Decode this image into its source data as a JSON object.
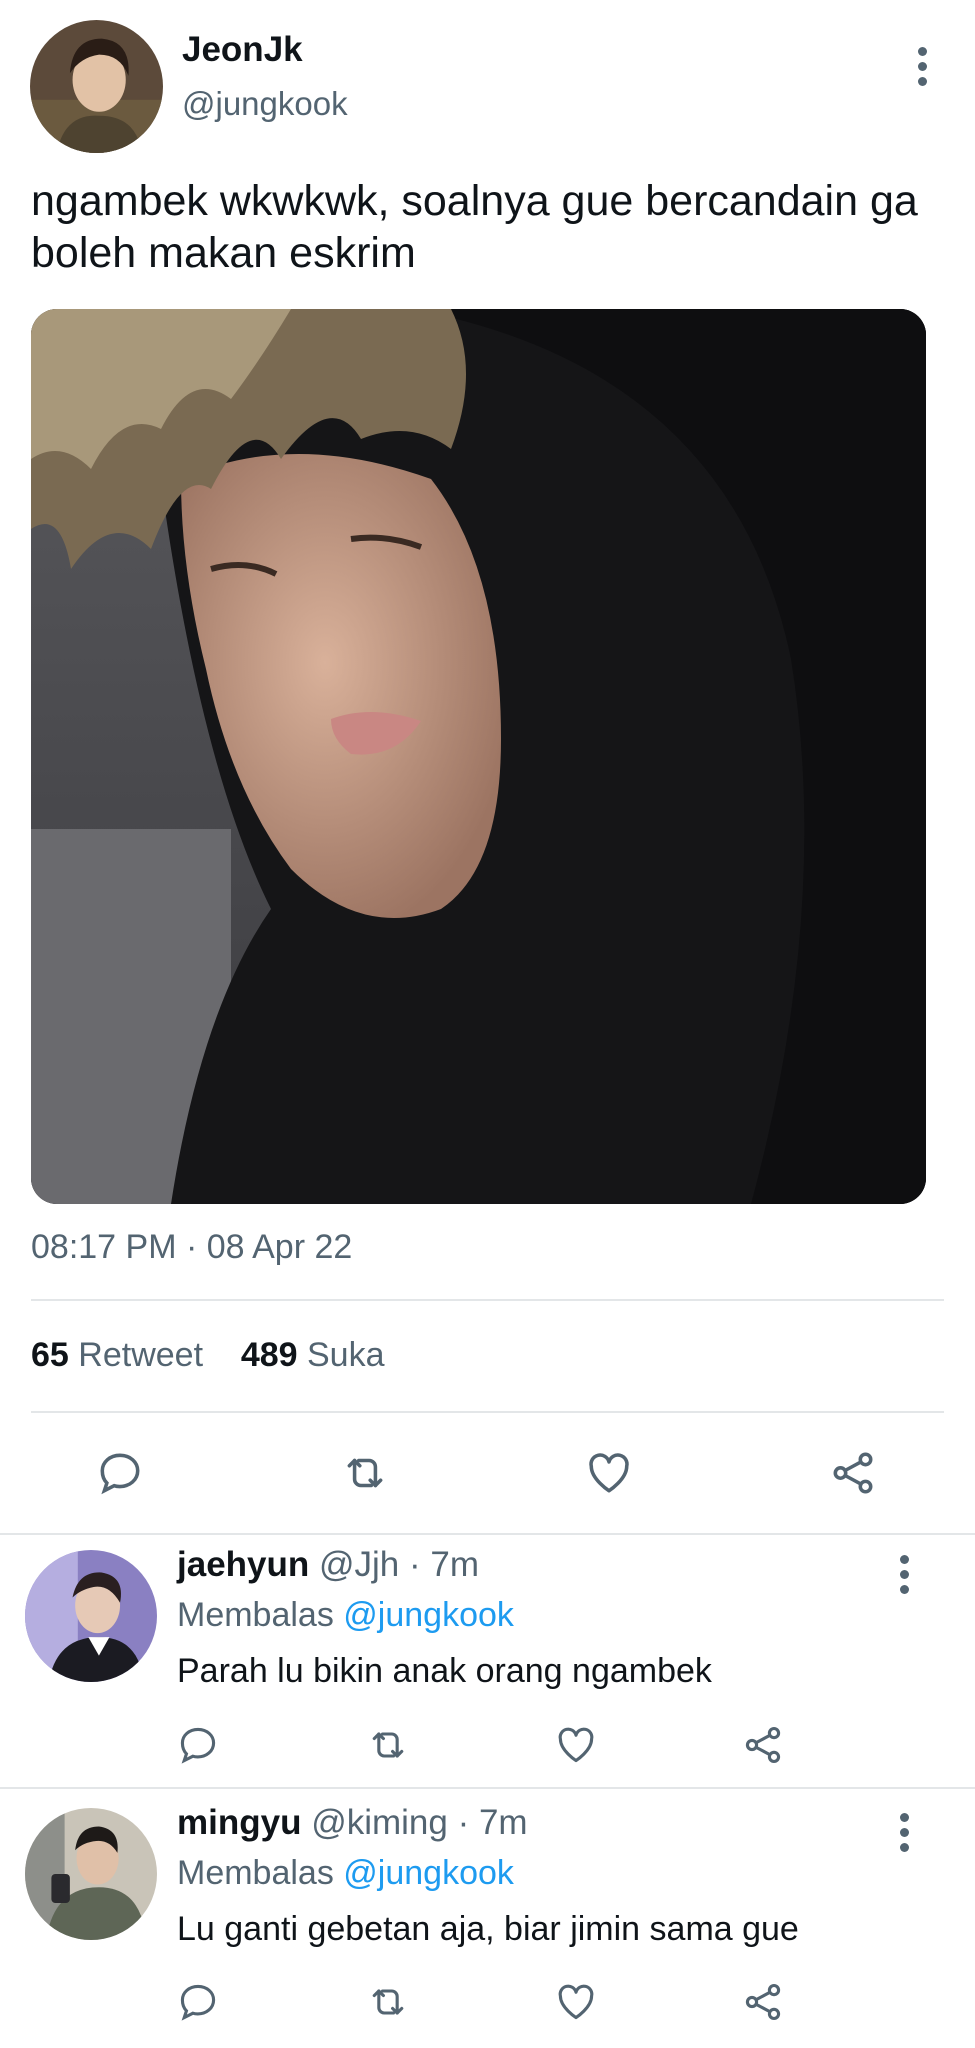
{
  "tweet": {
    "display_name": "JeonJk",
    "handle": "@jungkook",
    "text": "ngambek wkwkwk, soalnya gue bercandain ga boleh makan eskrim",
    "timestamp": "08:17 PM · 08 Apr 22",
    "retweet_count": "65",
    "retweet_label": "Retweet",
    "like_count": "489",
    "like_label": "Suka"
  },
  "icons": {
    "reply": "reply-icon",
    "retweet": "retweet-icon",
    "like": "heart-icon",
    "share": "share-icon",
    "more": "more-vertical-icon"
  },
  "replies": [
    {
      "display_name": "jaehyun",
      "meta": "@Jjh · 7m",
      "replying_prefix": "Membalas",
      "replying_to": "@jungkook",
      "text": "Parah lu bikin anak orang ngambek"
    },
    {
      "display_name": "mingyu",
      "meta": "@kiming · 7m",
      "replying_prefix": "Membalas",
      "replying_to": "@jungkook",
      "text": "Lu ganti gebetan aja, biar jimin sama gue"
    }
  ],
  "colors": {
    "text_primary": "#0f1419",
    "text_secondary": "#536471",
    "link": "#1d9bf0",
    "divider": "#e3e6e8"
  }
}
